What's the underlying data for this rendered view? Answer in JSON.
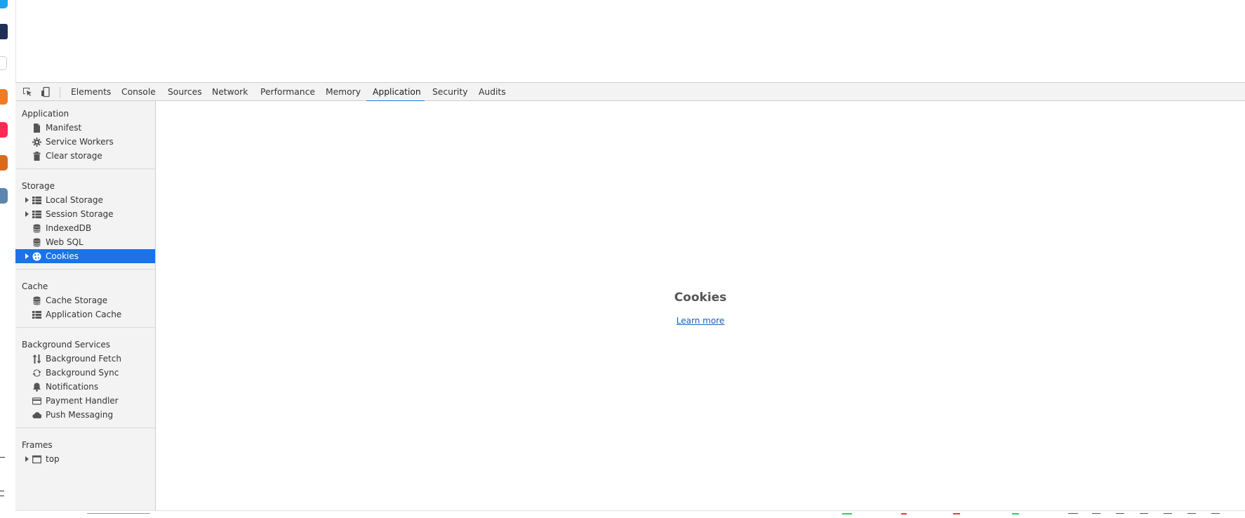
{
  "toolbar": {
    "tabs": [
      {
        "label": "Elements"
      },
      {
        "label": "Console"
      },
      {
        "label": "Sources"
      },
      {
        "label": "Network"
      },
      {
        "label": "Performance"
      },
      {
        "label": "Memory"
      },
      {
        "label": "Application",
        "active": true
      },
      {
        "label": "Security"
      },
      {
        "label": "Audits"
      }
    ],
    "icons": [
      "inspect-element-icon",
      "device-toolbar-icon"
    ]
  },
  "sidebar": {
    "sections": [
      {
        "title": "Application",
        "items": [
          {
            "label": "Manifest",
            "icon": "document-icon"
          },
          {
            "label": "Service Workers",
            "icon": "gear-icon"
          },
          {
            "label": "Clear storage",
            "icon": "trash-icon"
          }
        ]
      },
      {
        "title": "Storage",
        "items": [
          {
            "label": "Local Storage",
            "icon": "grid-icon",
            "expandable": true
          },
          {
            "label": "Session Storage",
            "icon": "grid-icon",
            "expandable": true
          },
          {
            "label": "IndexedDB",
            "icon": "database-icon"
          },
          {
            "label": "Web SQL",
            "icon": "database-icon"
          },
          {
            "label": "Cookies",
            "icon": "cookie-icon",
            "expandable": true,
            "selected": true
          }
        ]
      },
      {
        "title": "Cache",
        "items": [
          {
            "label": "Cache Storage",
            "icon": "database-icon"
          },
          {
            "label": "Application Cache",
            "icon": "grid-icon"
          }
        ]
      },
      {
        "title": "Background Services",
        "items": [
          {
            "label": "Background Fetch",
            "icon": "up-down-arrows-icon"
          },
          {
            "label": "Background Sync",
            "icon": "sync-icon"
          },
          {
            "label": "Notifications",
            "icon": "bell-icon"
          },
          {
            "label": "Payment Handler",
            "icon": "credit-card-icon"
          },
          {
            "label": "Push Messaging",
            "icon": "cloud-icon"
          }
        ]
      },
      {
        "title": "Frames",
        "items": [
          {
            "label": "top",
            "icon": "frame-icon",
            "expandable": true
          }
        ]
      }
    ]
  },
  "main": {
    "title": "Cookies",
    "link": "Learn more"
  },
  "colors": {
    "accent": "#1a73e8",
    "toolbar_bg": "#f3f3f3",
    "link": "#1a5fb4"
  }
}
